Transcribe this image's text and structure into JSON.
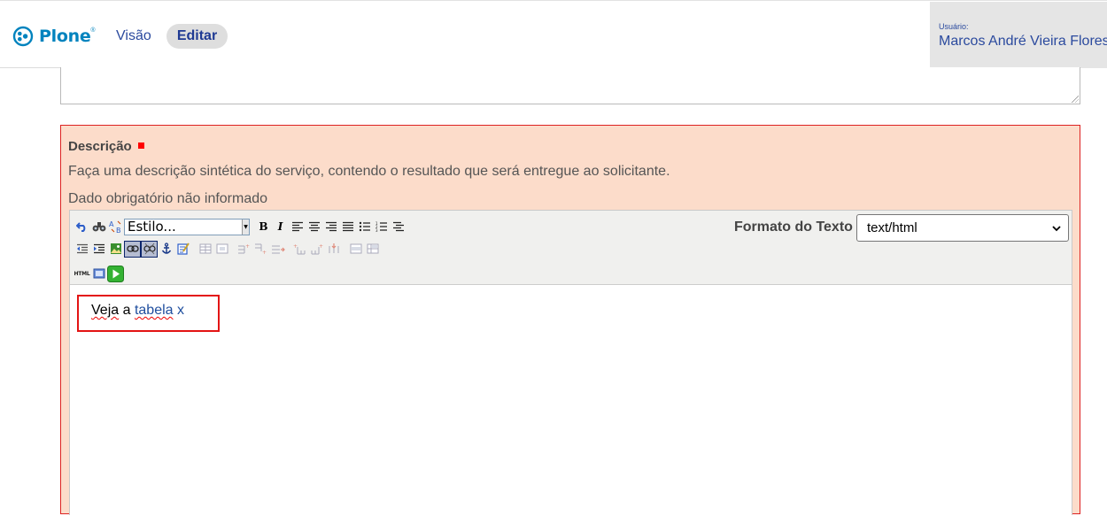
{
  "header": {
    "logo_text": "Plone",
    "logo_tm": "®",
    "nav_view": "Visão",
    "nav_edit": "Editar",
    "user_caption": "Usuário:",
    "user_name": "Marcos André Vieira Flores"
  },
  "field": {
    "label": "Descrição",
    "required": true,
    "help": "Faça uma descrição sintética do serviço, contendo o resultado que será entregue ao solicitante.",
    "error": "Dado obrigatório não informado"
  },
  "editor": {
    "style_select_value": "Estilo...",
    "format_label": "Formato do Texto",
    "format_value": "text/html",
    "toolbar_icons": {
      "row1": [
        "undo-icon",
        "find-icon",
        "replace-icon",
        "style-select",
        "bold-icon",
        "italic-icon",
        "align-left-icon",
        "align-center-icon",
        "align-right-icon",
        "align-justify-icon",
        "bullet-list-icon",
        "numbered-list-icon",
        "definition-list-icon"
      ],
      "row2": [
        "outdent-icon",
        "indent-icon",
        "insert-image-icon",
        "insert-link-icon",
        "unlink-icon",
        "anchor-icon",
        "cleanup-icon",
        "table-icon",
        "table-props-icon",
        "row-insert-icon",
        "row-before-icon",
        "row-delete-icon",
        "col-before-icon",
        "col-after-icon",
        "col-delete-icon",
        "merge-cells-icon",
        "split-cells-icon"
      ],
      "row3": [
        "html-source-icon",
        "fullscreen-icon",
        "save-icon"
      ]
    },
    "content": {
      "word1": "Veja",
      "word2": "a",
      "link_text": "tabela x"
    }
  },
  "colors": {
    "brand": "#0083be",
    "nav_link": "#2b4a9e",
    "error_bg": "#fcdcca",
    "error_border": "#dd2222",
    "highlight": "#e31414"
  }
}
